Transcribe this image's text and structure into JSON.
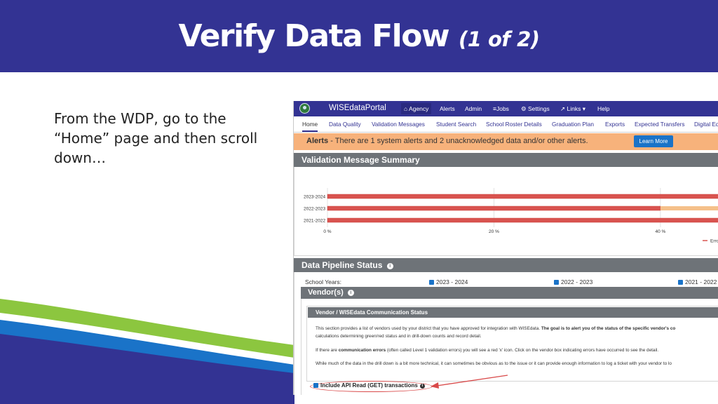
{
  "slide": {
    "title_main": "Verify Data Flow",
    "title_sub": "(1 of 2)",
    "instruction": "From the WDP, go to the “Home” page and then scroll down…",
    "colors": {
      "header": "#333393",
      "wave_green": "#8cc63f",
      "wave_blue": "#1a73c8"
    }
  },
  "portal": {
    "brand": "WISEdataPortal",
    "topnav": [
      {
        "label": "Agency",
        "icon": "home-icon",
        "active": true
      },
      {
        "label": "Alerts"
      },
      {
        "label": "Admin"
      },
      {
        "label": "Jobs",
        "icon": "database-icon"
      },
      {
        "label": "Settings",
        "icon": "gear-icon"
      },
      {
        "label": "Links",
        "icon": "external-link-icon"
      },
      {
        "label": "Help"
      }
    ],
    "subnav": [
      "Home",
      "Data Quality",
      "Validation Messages",
      "Student Search",
      "School Roster Details",
      "Graduation Plan",
      "Exports",
      "Expected Transfers",
      "Digital Eq"
    ],
    "alert": {
      "label": "Alerts",
      "text": " - There are 1 system alerts and 2 unacknowledged data and/or other alerts.",
      "button": "Learn More"
    },
    "validation_summary_title": "Validation Message Summary",
    "pipeline": {
      "title": "Data Pipeline Status",
      "school_years_label": "School Years:",
      "years": [
        "2023 - 2024",
        "2022 - 2023",
        "2021 - 2022"
      ]
    },
    "vendor": {
      "title": "Vendor(s)",
      "comm_title": "Vendor / WISEdata Communication Status",
      "para1a": "This section provides a list of vendors used by your district that you have approved for integration with WISEdata. ",
      "para1b": "The goal is to alert you of the status of the specific vendor's co",
      "para1c": "calculations determining green/red status and in drill-down counts and record detail.",
      "para2a": "If there are ",
      "para2b": "communication errors",
      "para2c": " (often called Level 1 validation errors) you will see a red 'x' icon. Click on the vendor box indicating errors have occurred to see the detail.",
      "para3": "While much of the data in the drill down is a bit more technical, it can sometimes be obvious as to the issue or it can provide enough information to log a ticket with your vendor to lo",
      "api_label": "Include API Read (GET) transactions"
    }
  },
  "chart_data": {
    "type": "bar",
    "orientation": "horizontal",
    "stacked": true,
    "categories": [
      "2023-2024",
      "2022-2023",
      "2021-2022"
    ],
    "x_ticks": [
      "0 %",
      "20 %",
      "40 %"
    ],
    "xlim": [
      0,
      47
    ],
    "series": [
      {
        "name": "Erro",
        "color": "#d9534f",
        "values": [
          47,
          40,
          47
        ]
      },
      {
        "color": "#f5c08a",
        "values": [
          0,
          7,
          0
        ]
      }
    ],
    "grid": true,
    "legend": "bottom-right"
  }
}
